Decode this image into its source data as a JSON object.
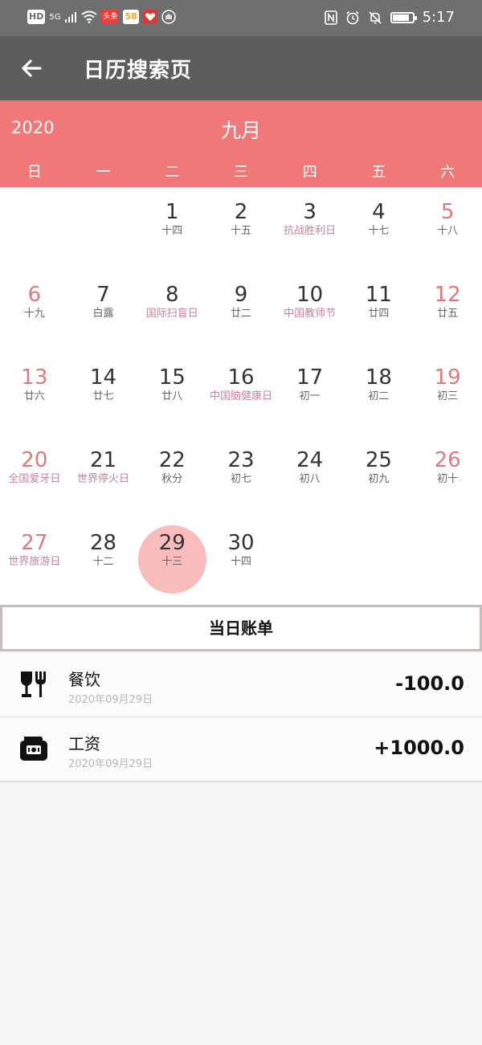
{
  "status_bar": {
    "left_chips": [
      "HD",
      "5G",
      "头条",
      "58"
    ],
    "time": "5:17"
  },
  "app_bar": {
    "title": "日历搜索页"
  },
  "calendar": {
    "year": "2020",
    "month": "九月",
    "weekdays": [
      "日",
      "一",
      "二",
      "三",
      "四",
      "五",
      "六"
    ],
    "selected_day": "29",
    "weeks": [
      [
        null,
        null,
        {
          "day": "1",
          "sub": "十四"
        },
        {
          "day": "2",
          "sub": "十五"
        },
        {
          "day": "3",
          "sub": "抗战胜利日",
          "festival": true
        },
        {
          "day": "4",
          "sub": "十七"
        },
        {
          "day": "5",
          "sub": "十八"
        }
      ],
      [
        {
          "day": "6",
          "sub": "十九"
        },
        {
          "day": "7",
          "sub": "白露"
        },
        {
          "day": "8",
          "sub": "国际扫盲日",
          "festival": true
        },
        {
          "day": "9",
          "sub": "廿二"
        },
        {
          "day": "10",
          "sub": "中国教师节",
          "festival": true
        },
        {
          "day": "11",
          "sub": "廿四"
        },
        {
          "day": "12",
          "sub": "廿五"
        }
      ],
      [
        {
          "day": "13",
          "sub": "廿六"
        },
        {
          "day": "14",
          "sub": "廿七"
        },
        {
          "day": "15",
          "sub": "廿八"
        },
        {
          "day": "16",
          "sub": "中国脑健康日",
          "festival": true
        },
        {
          "day": "17",
          "sub": "初一"
        },
        {
          "day": "18",
          "sub": "初二"
        },
        {
          "day": "19",
          "sub": "初三"
        }
      ],
      [
        {
          "day": "20",
          "sub": "全国爱牙日",
          "festival": true
        },
        {
          "day": "21",
          "sub": "世界停火日",
          "festival": true
        },
        {
          "day": "22",
          "sub": "秋分"
        },
        {
          "day": "23",
          "sub": "初七"
        },
        {
          "day": "24",
          "sub": "初八"
        },
        {
          "day": "25",
          "sub": "初九"
        },
        {
          "day": "26",
          "sub": "初十"
        }
      ],
      [
        {
          "day": "27",
          "sub": "世界旅游日",
          "festival": true
        },
        {
          "day": "28",
          "sub": "十二"
        },
        {
          "day": "29",
          "sub": "十三"
        },
        {
          "day": "30",
          "sub": "十四"
        },
        null,
        null,
        null
      ]
    ]
  },
  "bills": {
    "header": "当日账单",
    "items": [
      {
        "icon": "fork-knife-glass-icon",
        "name": "餐饮",
        "date": "2020年09月29日",
        "amount": "-100.0"
      },
      {
        "icon": "wallet-money-icon",
        "name": "工资",
        "date": "2020年09月29日",
        "amount": "+1000.0"
      }
    ]
  },
  "colors": {
    "calendar_header": "#f07878",
    "weekend": "#e07a7a",
    "festival": "#c583a0",
    "selected": "#f8bcbc",
    "app_bar": "#5d5d5d"
  }
}
